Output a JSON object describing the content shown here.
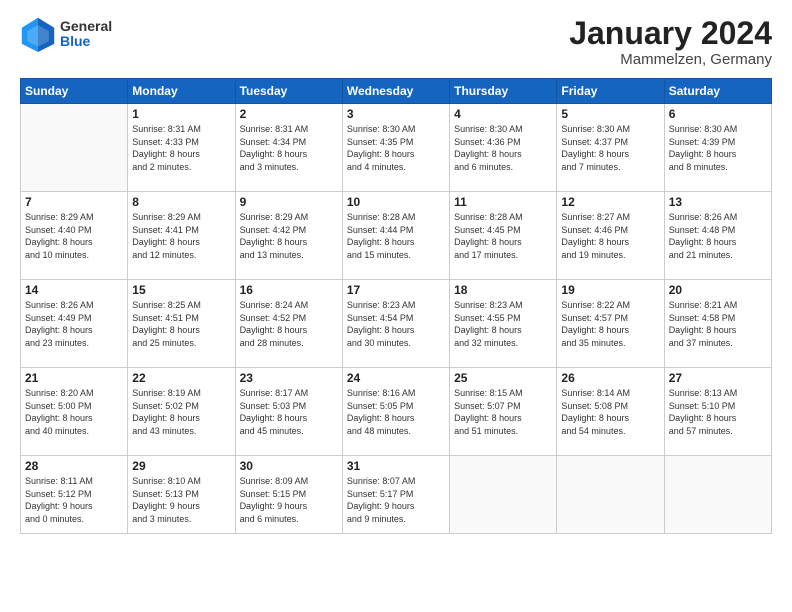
{
  "header": {
    "logo": {
      "general": "General",
      "blue": "Blue"
    },
    "title": "January 2024",
    "location": "Mammelzen, Germany"
  },
  "calendar": {
    "days_of_week": [
      "Sunday",
      "Monday",
      "Tuesday",
      "Wednesday",
      "Thursday",
      "Friday",
      "Saturday"
    ],
    "weeks": [
      [
        {
          "day": "",
          "info": ""
        },
        {
          "day": "1",
          "info": "Sunrise: 8:31 AM\nSunset: 4:33 PM\nDaylight: 8 hours\nand 2 minutes."
        },
        {
          "day": "2",
          "info": "Sunrise: 8:31 AM\nSunset: 4:34 PM\nDaylight: 8 hours\nand 3 minutes."
        },
        {
          "day": "3",
          "info": "Sunrise: 8:30 AM\nSunset: 4:35 PM\nDaylight: 8 hours\nand 4 minutes."
        },
        {
          "day": "4",
          "info": "Sunrise: 8:30 AM\nSunset: 4:36 PM\nDaylight: 8 hours\nand 6 minutes."
        },
        {
          "day": "5",
          "info": "Sunrise: 8:30 AM\nSunset: 4:37 PM\nDaylight: 8 hours\nand 7 minutes."
        },
        {
          "day": "6",
          "info": "Sunrise: 8:30 AM\nSunset: 4:39 PM\nDaylight: 8 hours\nand 8 minutes."
        }
      ],
      [
        {
          "day": "7",
          "info": "Sunrise: 8:29 AM\nSunset: 4:40 PM\nDaylight: 8 hours\nand 10 minutes."
        },
        {
          "day": "8",
          "info": "Sunrise: 8:29 AM\nSunset: 4:41 PM\nDaylight: 8 hours\nand 12 minutes."
        },
        {
          "day": "9",
          "info": "Sunrise: 8:29 AM\nSunset: 4:42 PM\nDaylight: 8 hours\nand 13 minutes."
        },
        {
          "day": "10",
          "info": "Sunrise: 8:28 AM\nSunset: 4:44 PM\nDaylight: 8 hours\nand 15 minutes."
        },
        {
          "day": "11",
          "info": "Sunrise: 8:28 AM\nSunset: 4:45 PM\nDaylight: 8 hours\nand 17 minutes."
        },
        {
          "day": "12",
          "info": "Sunrise: 8:27 AM\nSunset: 4:46 PM\nDaylight: 8 hours\nand 19 minutes."
        },
        {
          "day": "13",
          "info": "Sunrise: 8:26 AM\nSunset: 4:48 PM\nDaylight: 8 hours\nand 21 minutes."
        }
      ],
      [
        {
          "day": "14",
          "info": "Sunrise: 8:26 AM\nSunset: 4:49 PM\nDaylight: 8 hours\nand 23 minutes."
        },
        {
          "day": "15",
          "info": "Sunrise: 8:25 AM\nSunset: 4:51 PM\nDaylight: 8 hours\nand 25 minutes."
        },
        {
          "day": "16",
          "info": "Sunrise: 8:24 AM\nSunset: 4:52 PM\nDaylight: 8 hours\nand 28 minutes."
        },
        {
          "day": "17",
          "info": "Sunrise: 8:23 AM\nSunset: 4:54 PM\nDaylight: 8 hours\nand 30 minutes."
        },
        {
          "day": "18",
          "info": "Sunrise: 8:23 AM\nSunset: 4:55 PM\nDaylight: 8 hours\nand 32 minutes."
        },
        {
          "day": "19",
          "info": "Sunrise: 8:22 AM\nSunset: 4:57 PM\nDaylight: 8 hours\nand 35 minutes."
        },
        {
          "day": "20",
          "info": "Sunrise: 8:21 AM\nSunset: 4:58 PM\nDaylight: 8 hours\nand 37 minutes."
        }
      ],
      [
        {
          "day": "21",
          "info": "Sunrise: 8:20 AM\nSunset: 5:00 PM\nDaylight: 8 hours\nand 40 minutes."
        },
        {
          "day": "22",
          "info": "Sunrise: 8:19 AM\nSunset: 5:02 PM\nDaylight: 8 hours\nand 43 minutes."
        },
        {
          "day": "23",
          "info": "Sunrise: 8:17 AM\nSunset: 5:03 PM\nDaylight: 8 hours\nand 45 minutes."
        },
        {
          "day": "24",
          "info": "Sunrise: 8:16 AM\nSunset: 5:05 PM\nDaylight: 8 hours\nand 48 minutes."
        },
        {
          "day": "25",
          "info": "Sunrise: 8:15 AM\nSunset: 5:07 PM\nDaylight: 8 hours\nand 51 minutes."
        },
        {
          "day": "26",
          "info": "Sunrise: 8:14 AM\nSunset: 5:08 PM\nDaylight: 8 hours\nand 54 minutes."
        },
        {
          "day": "27",
          "info": "Sunrise: 8:13 AM\nSunset: 5:10 PM\nDaylight: 8 hours\nand 57 minutes."
        }
      ],
      [
        {
          "day": "28",
          "info": "Sunrise: 8:11 AM\nSunset: 5:12 PM\nDaylight: 9 hours\nand 0 minutes."
        },
        {
          "day": "29",
          "info": "Sunrise: 8:10 AM\nSunset: 5:13 PM\nDaylight: 9 hours\nand 3 minutes."
        },
        {
          "day": "30",
          "info": "Sunrise: 8:09 AM\nSunset: 5:15 PM\nDaylight: 9 hours\nand 6 minutes."
        },
        {
          "day": "31",
          "info": "Sunrise: 8:07 AM\nSunset: 5:17 PM\nDaylight: 9 hours\nand 9 minutes."
        },
        {
          "day": "",
          "info": ""
        },
        {
          "day": "",
          "info": ""
        },
        {
          "day": "",
          "info": ""
        }
      ]
    ]
  }
}
